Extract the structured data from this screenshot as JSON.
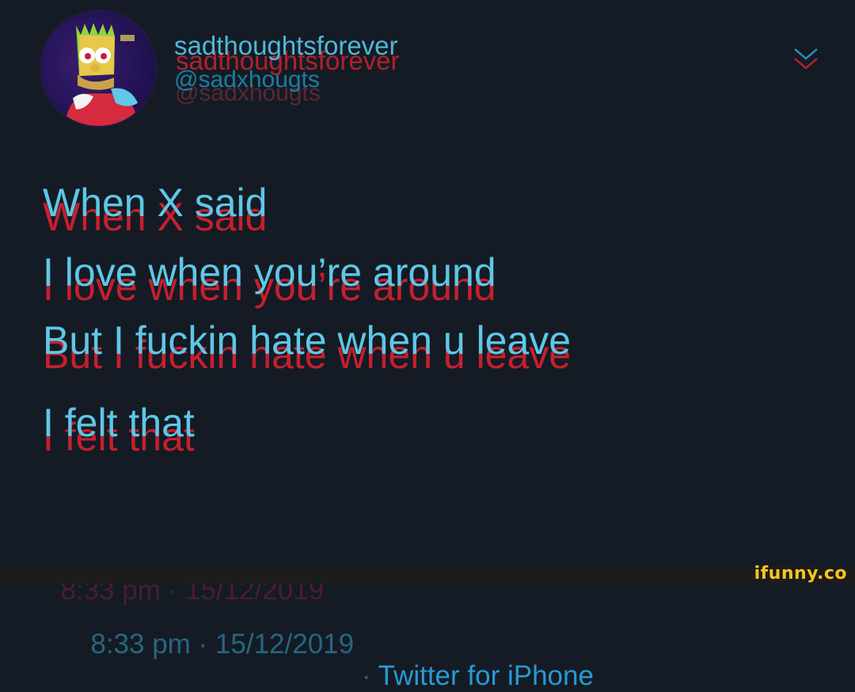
{
  "profile": {
    "avatar_icon": "bart-simpson-avatar",
    "display_name": "sadthoughtsforever",
    "handle": "@sadxhougts"
  },
  "header": {
    "menu_icon": "chevron-down-icon"
  },
  "tweet": {
    "lines": [
      "When X said",
      "I love when you’re around",
      "But I fuckin hate when u leave",
      "I felt that"
    ]
  },
  "meta": {
    "timestamp": "8:33 pm · 15/12/2019",
    "separator": " · ",
    "source": "Twitter for iPhone"
  },
  "watermark": {
    "text": "ifunny.co"
  },
  "colors": {
    "background": "#141b24",
    "text_cyan": "#5fc7e6",
    "ghost_red": "#c61f2f",
    "link_blue": "#2899d6",
    "watermark_yellow": "#f7c520"
  }
}
